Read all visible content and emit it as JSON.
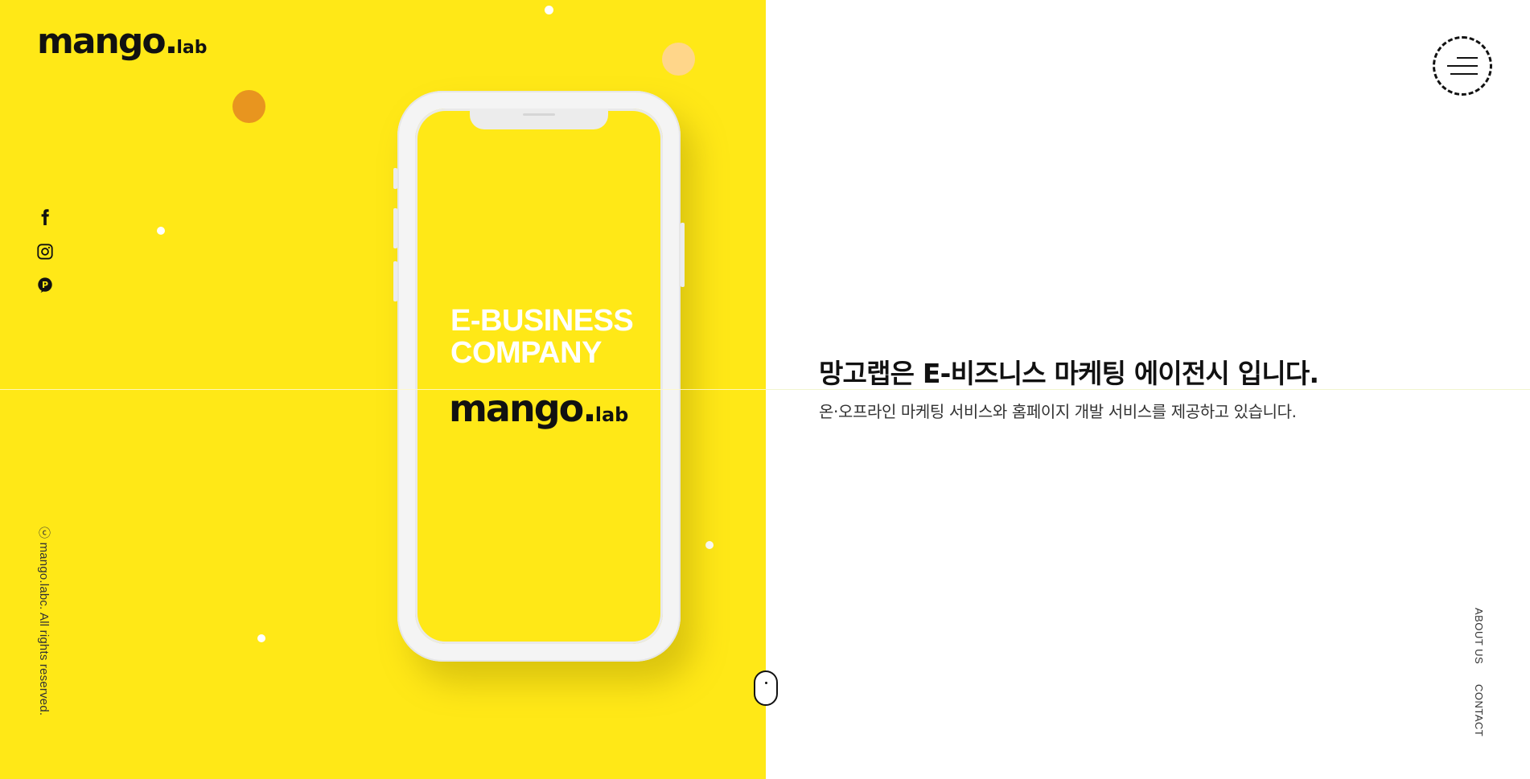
{
  "brand": {
    "logo_main": "mango",
    "logo_dot": ".",
    "logo_suffix": "lab"
  },
  "social": [
    {
      "name": "facebook",
      "icon": "facebook-icon"
    },
    {
      "name": "instagram",
      "icon": "instagram-icon"
    },
    {
      "name": "pinterest",
      "icon": "pinterest-icon"
    }
  ],
  "footer": {
    "copyright": "ⓒ mango.labc. All rights reserved."
  },
  "phone_screen": {
    "line1": "E-BUSINESS",
    "line2": "COMPANY",
    "logo_main": "mango",
    "logo_dot": ".",
    "logo_suffix": "lab"
  },
  "hero": {
    "headline": "망고랩은 E-비즈니스 마케팅 에이전시 입니다.",
    "subline": "온·오프라인 마케팅 서비스와 홈페이지 개발 서비스를 제공하고 있습니다."
  },
  "nav": {
    "menu_icon": "hamburger-menu-icon",
    "about": "ABOUT US",
    "contact": "CONTACT"
  },
  "colors": {
    "brand_yellow": "#ffe817",
    "bubble_orange": "#e8951f",
    "bubble_peach": "#ffd68a",
    "text_dark": "#111111"
  }
}
